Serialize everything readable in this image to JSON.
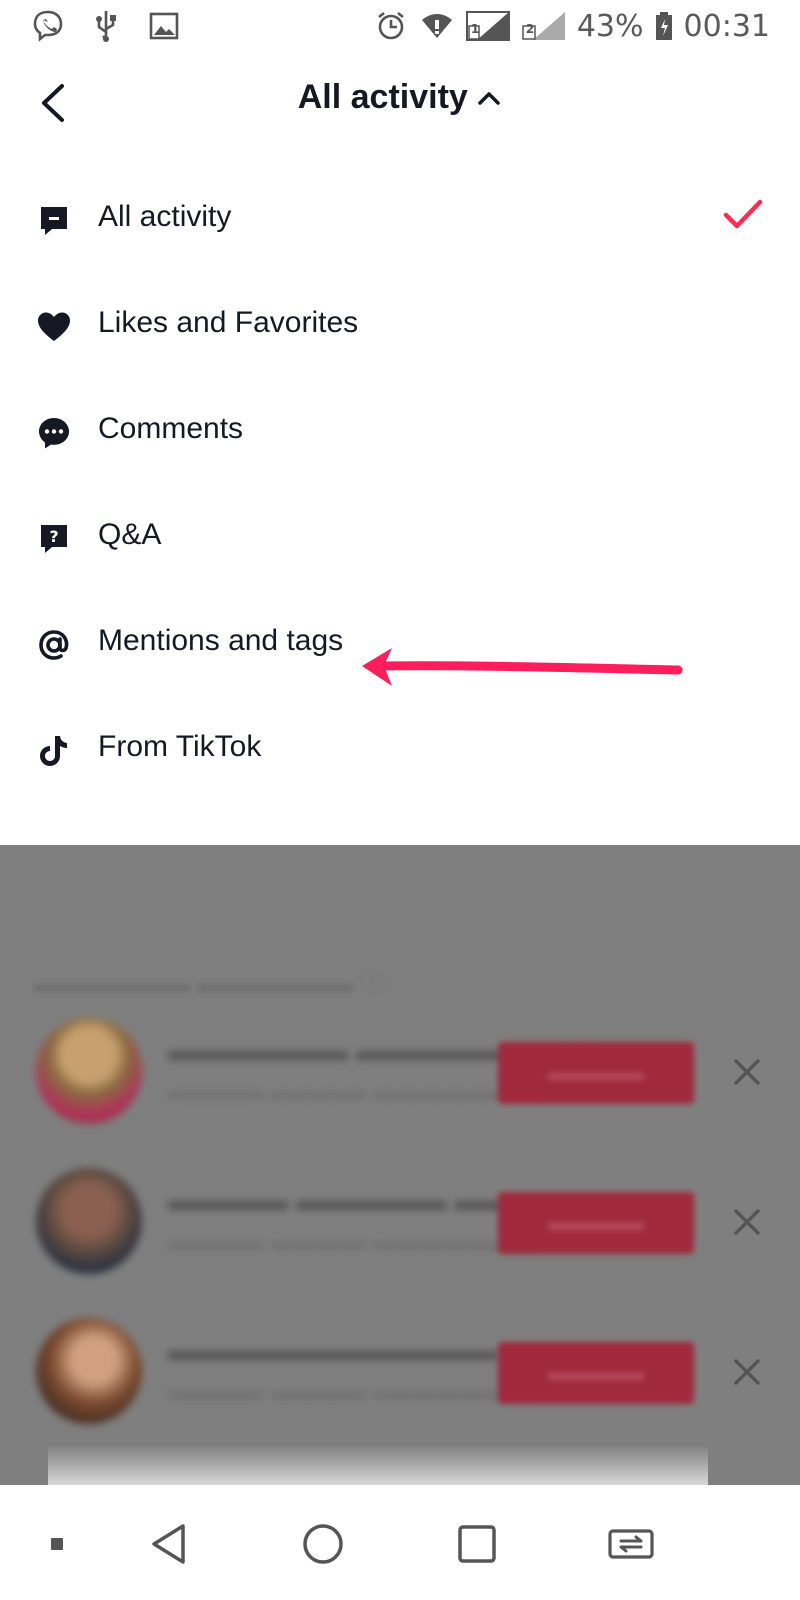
{
  "status_bar": {
    "battery": "43%",
    "time": "00:31",
    "sim1_label": "1",
    "sim2_label": "2",
    "left_icons": [
      "viber-icon",
      "usb-icon",
      "gallery-icon"
    ],
    "right_icons": [
      "alarm-icon",
      "wifi-icon",
      "signal-sim1-icon",
      "signal-sim2-icon",
      "battery-icon"
    ]
  },
  "header": {
    "title": "All activity",
    "back_icon": "chevron-left-icon",
    "title_icon": "chevron-up-icon"
  },
  "menu": {
    "items": [
      {
        "label": "All activity",
        "icon": "activity-icon",
        "selected": true
      },
      {
        "label": "Likes and Favorites",
        "icon": "heart-icon",
        "selected": false
      },
      {
        "label": "Comments",
        "icon": "comment-icon",
        "selected": false
      },
      {
        "label": "Q&A",
        "icon": "question-icon",
        "selected": false
      },
      {
        "label": "Mentions and tags",
        "icon": "at-icon",
        "selected": false
      },
      {
        "label": "From TikTok",
        "icon": "tiktok-icon",
        "selected": false
      }
    ],
    "check_icon": "check-icon"
  },
  "colors": {
    "accent": "#fe2c55",
    "text": "#161823",
    "dim_overlay": "#7f7f7f",
    "arrow": "#fe1d5d"
  },
  "navbar": {
    "icons": [
      "small-square-icon",
      "back-triangle-icon",
      "home-circle-icon",
      "recents-square-icon",
      "switch-app-icon"
    ]
  }
}
